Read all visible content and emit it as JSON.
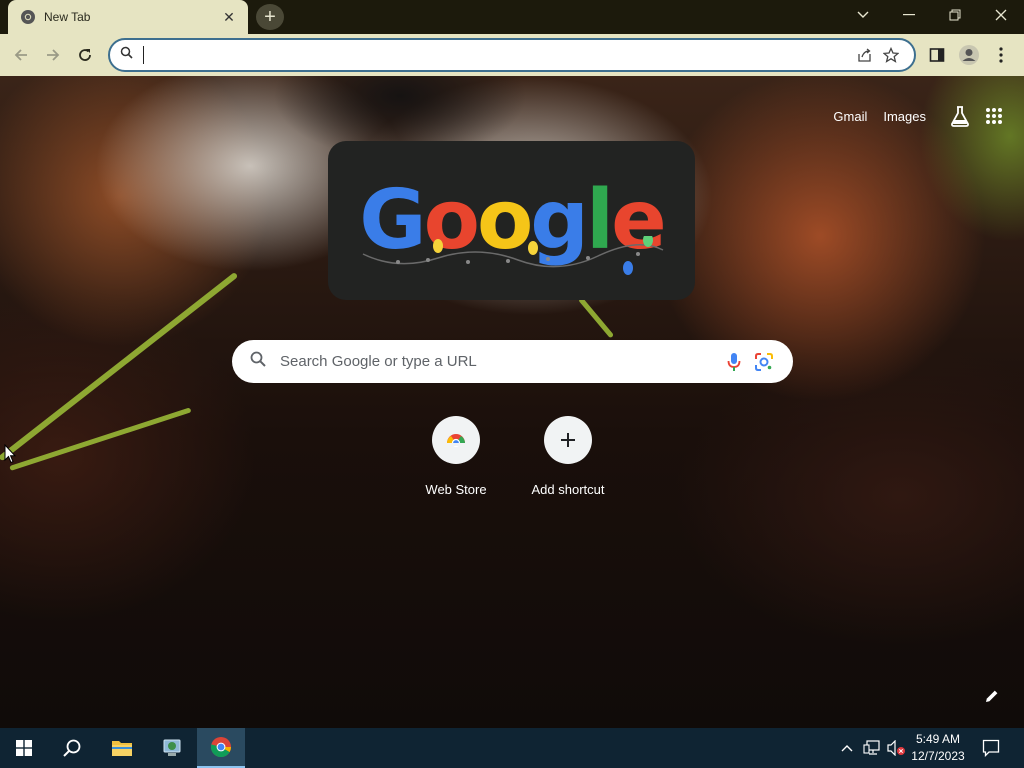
{
  "browser": {
    "tab": {
      "title": "New Tab",
      "favicon": "chrome-icon"
    },
    "window_controls": [
      "tab-search-chevron-icon",
      "minimize-icon",
      "restore-icon",
      "close-icon"
    ],
    "omnibox": {
      "value": "",
      "placeholder": ""
    }
  },
  "page": {
    "top_links": {
      "gmail": "Gmail",
      "images": "Images"
    },
    "doodle": {
      "text": "Google"
    },
    "search": {
      "placeholder": "Search Google or type a URL"
    },
    "shortcuts": [
      {
        "label": "Web Store",
        "icon": "web-store-icon"
      },
      {
        "label": "Add shortcut",
        "icon": "plus-icon"
      }
    ]
  },
  "taskbar": {
    "time": "5:49 AM",
    "date": "12/7/2023",
    "apps": [
      "windows-start-icon",
      "search-icon",
      "file-explorer-icon",
      "network-icon",
      "chrome-icon"
    ]
  },
  "colors": {
    "tab_strip": "#1c1a0c",
    "toolbar": "#e6e4c2",
    "omnibox_border": "#3d6f8f",
    "taskbar": "#0f2433"
  }
}
